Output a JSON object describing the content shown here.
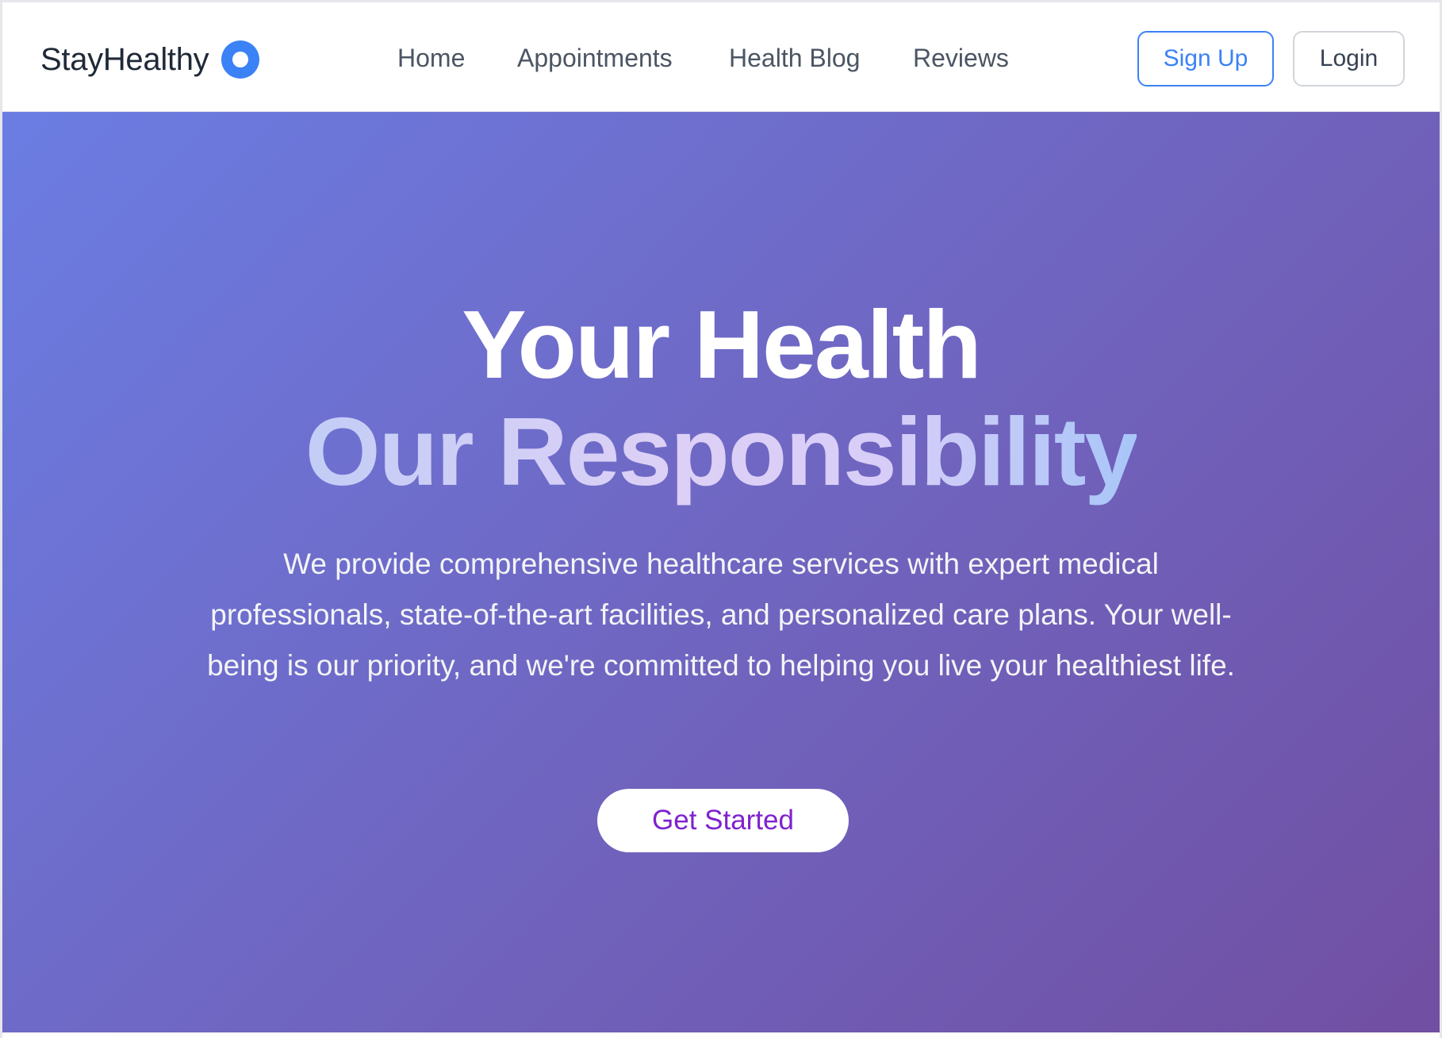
{
  "brand": {
    "name": "StayHealthy",
    "logo_icon": "ring-logo-icon",
    "accent_color": "#3b82f6"
  },
  "nav": {
    "links": [
      "Home",
      "Appointments",
      "Health Blog",
      "Reviews"
    ],
    "signup_label": "Sign Up",
    "login_label": "Login"
  },
  "hero": {
    "title_line1": "Your Health",
    "title_line2": "Our Responsibility",
    "description": "We provide comprehensive healthcare services with expert medical professionals, state-of-the-art facilities, and personalized care plans. Your well-being is our priority, and we're committed to helping you live your healthiest life.",
    "cta_label": "Get Started",
    "cta_color": "#7e22ce",
    "gradient_start": "#6b7de3",
    "gradient_end": "#714fa2"
  }
}
